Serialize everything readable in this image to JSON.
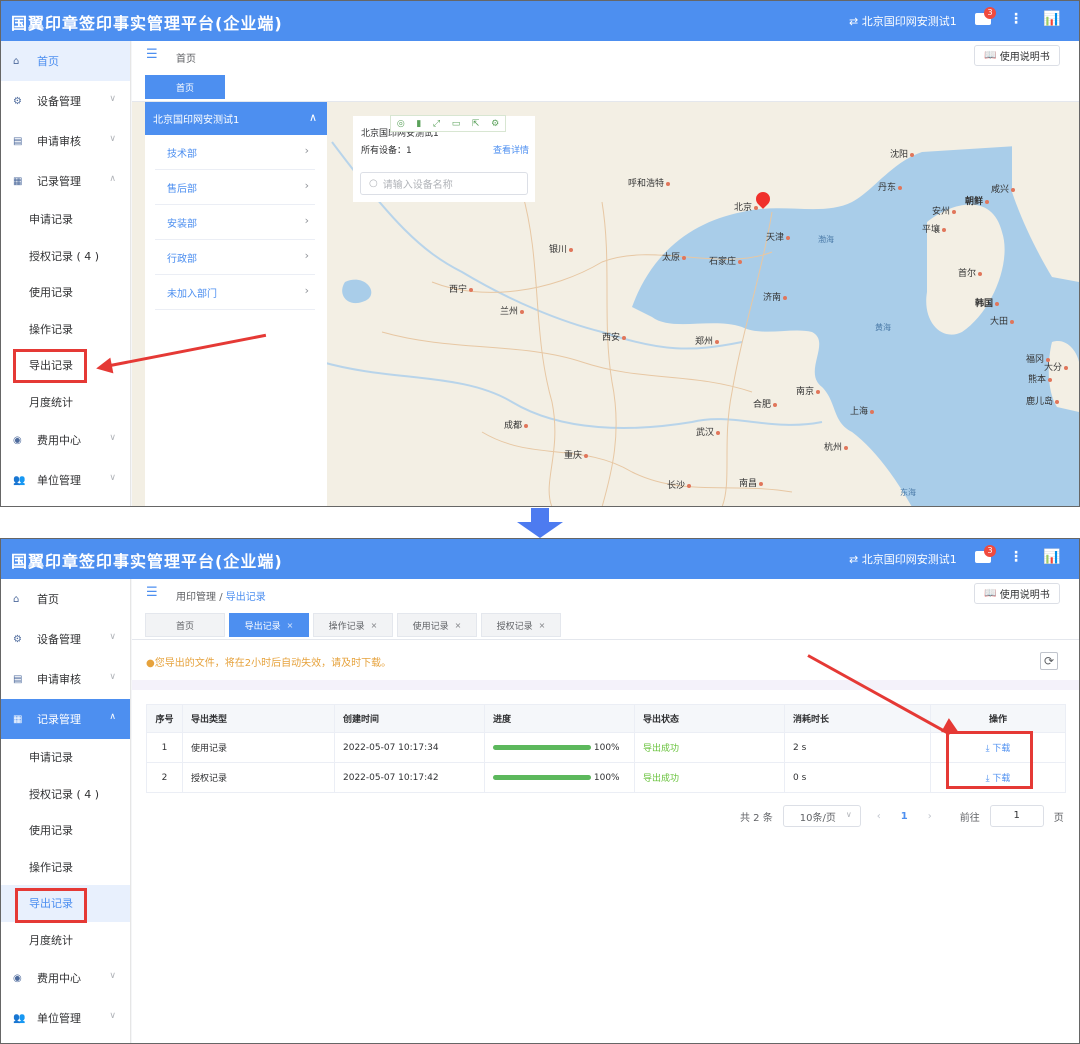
{
  "app_title": "国翼印章签印事实管理平台(企业端)",
  "header": {
    "device_name": "北京国印网安测试1",
    "mail_badge": "3",
    "more_icon": "⋮",
    "chart_icon": "chart-icon"
  },
  "manual_button": "使用说明书",
  "sidebar_top": {
    "home": "首页",
    "device": "设备管理",
    "review": "申请审核",
    "records": "记录管理",
    "sub": [
      "申请记录",
      "授权记录 ( 4 )",
      "使用记录",
      "操作记录",
      "导出记录",
      "月度统计"
    ],
    "fees": "费用中心",
    "org": "单位管理"
  },
  "screen1": {
    "breadcrumb": "首页",
    "tab": "首页",
    "org_name": "北京国印网安测试1",
    "departments": [
      "技术部",
      "售后部",
      "安装部",
      "行政部",
      "未加入部门"
    ],
    "card_name": "北京国印网安测试1",
    "card_count": "所有设备：1",
    "card_link": "查看详情",
    "search_placeholder": "请输入设备名称",
    "cities": [
      "呼和浩特",
      "北京",
      "天津",
      "沈阳",
      "银川",
      "太原",
      "石家庄",
      "西宁",
      "兰州",
      "济南",
      "西安",
      "郑州",
      "南京",
      "合肥",
      "上海",
      "成都",
      "武汉",
      "杭州",
      "重庆",
      "长沙",
      "南昌",
      "朝鲜",
      "韩国",
      "首尔",
      "平壤",
      "安州",
      "咸兴",
      "大田",
      "丹东",
      "福冈",
      "大分",
      "熊本",
      "鹿儿岛"
    ],
    "seas": [
      "渤海",
      "黄海",
      "东海"
    ]
  },
  "screen2": {
    "breadcrumb_parent": "用印管理",
    "breadcrumb_sep": "/",
    "breadcrumb_current": "导出记录",
    "tabs": [
      "首页",
      "导出记录",
      "操作记录",
      "使用记录",
      "授权记录"
    ],
    "tab_close": "×",
    "warning": "●您导出的文件，将在2小时后自动失效，请及时下载。",
    "table": {
      "headers": [
        "序号",
        "导出类型",
        "创建时间",
        "进度",
        "导出状态",
        "消耗时长",
        "操作"
      ],
      "rows": [
        {
          "no": "1",
          "type": "使用记录",
          "created": "2022-05-07 10:17:34",
          "progress": 100,
          "progress_label": "100%",
          "status": "导出成功",
          "duration": "2 s",
          "action": "⤓ 下载"
        },
        {
          "no": "2",
          "type": "授权记录",
          "created": "2022-05-07 10:17:42",
          "progress": 100,
          "progress_label": "100%",
          "status": "导出成功",
          "duration": "0 s",
          "action": "⤓ 下载"
        }
      ]
    },
    "pagination": {
      "total": "共 2 条",
      "page_size": "10条/页",
      "prev": "‹",
      "page": "1",
      "next": "›",
      "goto": "前往",
      "goto_value": "1",
      "unit": "页"
    }
  },
  "colors": {
    "header_blue": "#4d8ff0",
    "annotation_red": "#e53935",
    "progress_green": "#5cb85c",
    "arrow_blue": "#4d7bf0"
  }
}
